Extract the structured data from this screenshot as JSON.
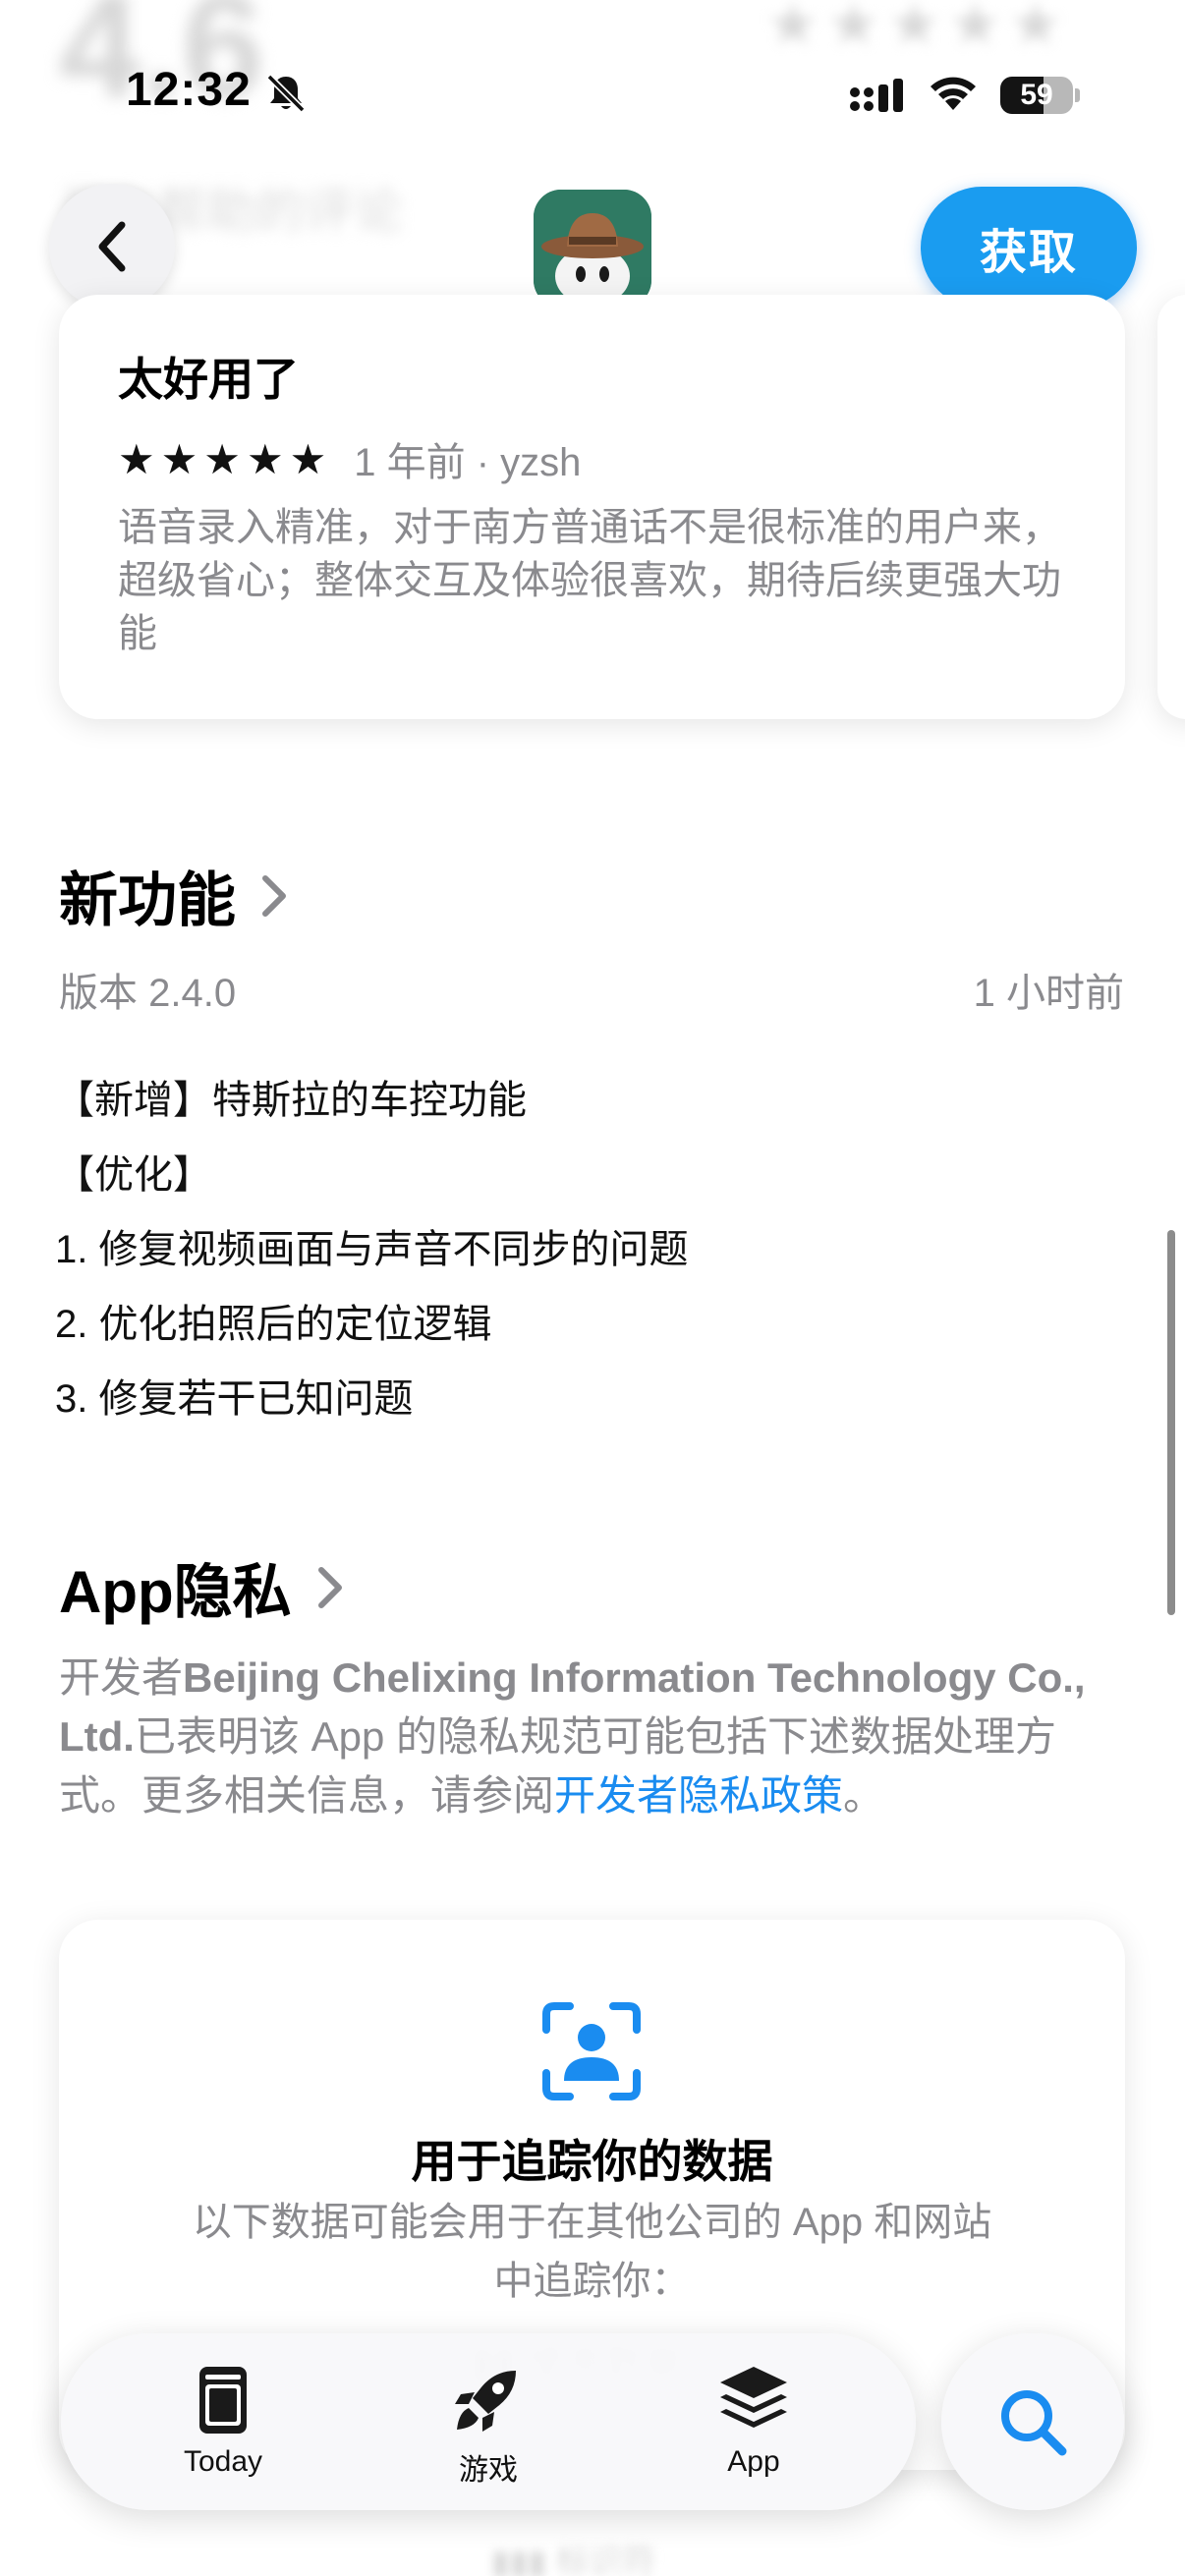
{
  "status_bar": {
    "time": "12:32",
    "battery": "59",
    "battery_level": 0.59
  },
  "nav": {
    "get_label": "获取"
  },
  "review": {
    "title": "太好用了",
    "stars": "★★★★★",
    "rating": 5,
    "meta": "1 年前 · yzsh",
    "body": "语音录入精准，对于南方普通话不是很标准的用户来，超级省心；整体交互及体验很喜欢，期待后续更强大功能"
  },
  "whats_new": {
    "title": "新功能",
    "version": "版本 2.4.0",
    "time": "1 小时前",
    "notes": [
      "【新增】特斯拉的车控功能",
      "【优化】",
      "1. 修复视频画面与声音不同步的问题",
      "2. 优化拍照后的定位逻辑",
      "3. 修复若干已知问题"
    ]
  },
  "privacy": {
    "title": "App隐私",
    "desc_prefix": "开发者",
    "developer": "Beijing Chelixing Information Technology Co., Ltd.",
    "desc_middle": "已表明该 App 的隐私规范可能包括下述数据处理方式。更多相关信息，请参阅",
    "link": "开发者隐私政策",
    "desc_suffix": "。",
    "card": {
      "title": "用于追踪你的数据",
      "desc": "以下数据可能会用于在其他公司的 App 和网站中追踪你："
    }
  },
  "tabs": [
    {
      "label": "Today",
      "icon": "today-icon"
    },
    {
      "label": "游戏",
      "icon": "rocket-icon"
    },
    {
      "label": "App",
      "icon": "app-stack-icon"
    }
  ],
  "colors": {
    "accent": "#1a9cf0",
    "secondary_text": "#8a8a8e",
    "app_icon_bg": "#2f7a63"
  }
}
